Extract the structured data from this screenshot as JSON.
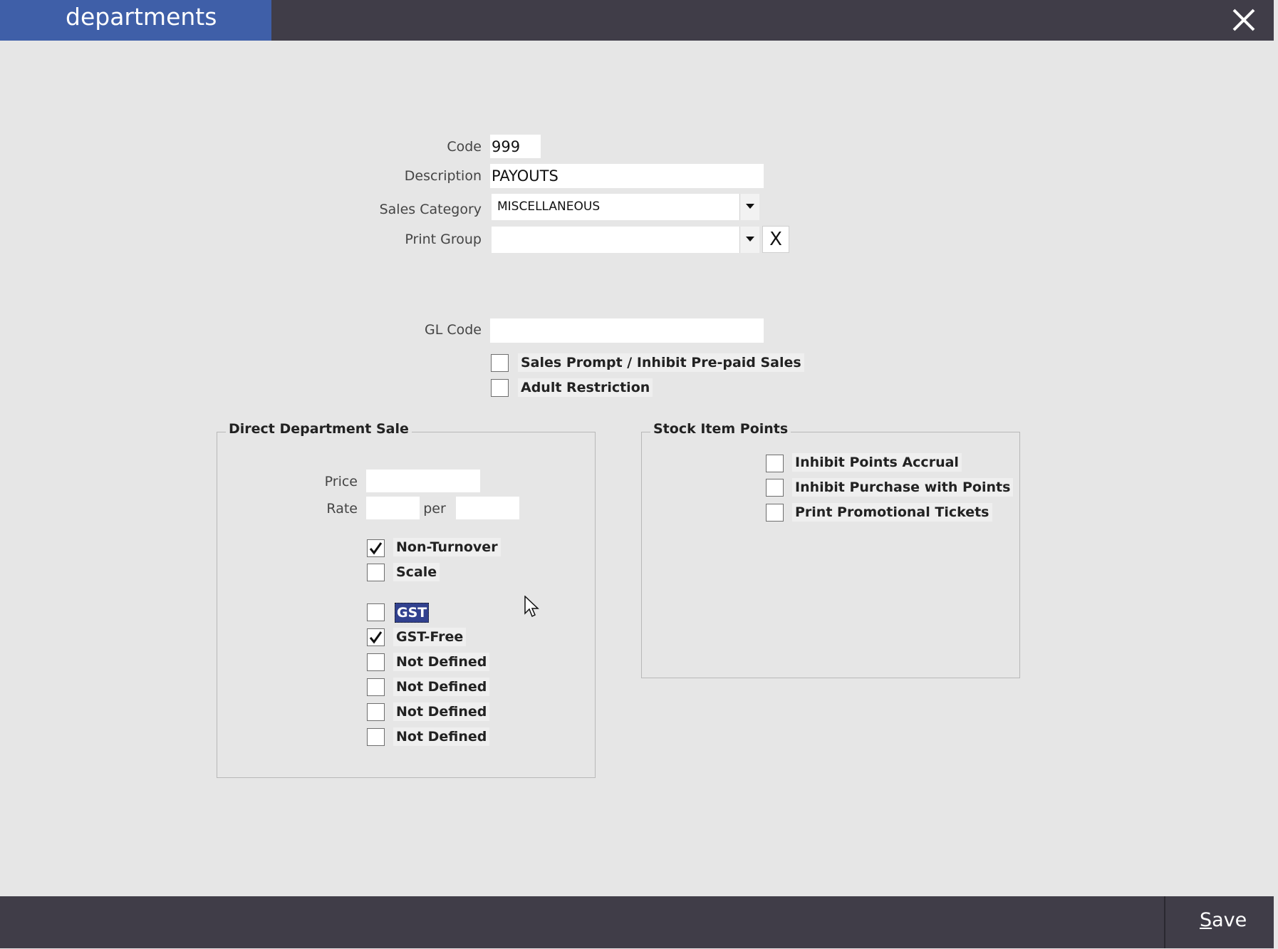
{
  "window": {
    "title": "departments",
    "close_icon": "close-icon"
  },
  "form": {
    "code_label": "Code",
    "code_value": "999",
    "description_label": "Description",
    "description_value": "PAYOUTS",
    "sales_category_label": "Sales Category",
    "sales_category_value": "MISCELLANEOUS",
    "print_group_label": "Print Group",
    "print_group_value": "",
    "print_group_clear": "X",
    "gl_code_label": "GL Code",
    "gl_code_value": ""
  },
  "options": [
    {
      "label": "Sales Prompt / Inhibit Pre-paid Sales",
      "checked": false
    },
    {
      "label": "Adult Restriction",
      "checked": false
    }
  ],
  "direct_sale": {
    "title": "Direct Department Sale",
    "price_label": "Price",
    "price_value": "",
    "rate_label": "Rate",
    "rate_value": "",
    "per_label": "per",
    "per_value": "",
    "checks": [
      {
        "label": "Non-Turnover",
        "checked": true
      },
      {
        "label": "Scale",
        "checked": false
      },
      {
        "label": "GST",
        "checked": false,
        "selected": true
      },
      {
        "label": "GST-Free",
        "checked": true
      },
      {
        "label": "Not Defined",
        "checked": false
      },
      {
        "label": "Not Defined",
        "checked": false
      },
      {
        "label": "Not Defined",
        "checked": false
      },
      {
        "label": "Not Defined",
        "checked": false
      }
    ]
  },
  "stock_points": {
    "title": "Stock Item Points",
    "checks": [
      {
        "label": "Inhibit Points Accrual",
        "checked": false
      },
      {
        "label": "Inhibit Purchase with Points",
        "checked": false
      },
      {
        "label": "Print Promotional Tickets",
        "checked": false
      }
    ]
  },
  "footer": {
    "save_mnemonic": "S",
    "save_rest": "ave"
  },
  "colors": {
    "title_bar": "#403d48",
    "title_tab": "#3f5fa8",
    "background": "#e6e6e6",
    "selection": "#31418f"
  }
}
